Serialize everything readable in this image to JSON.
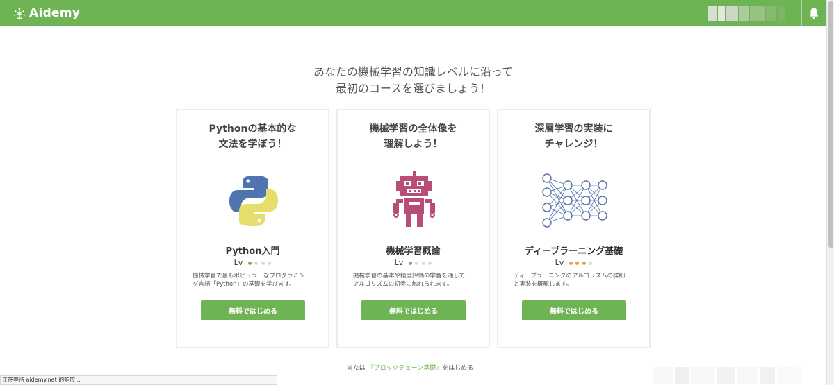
{
  "header": {
    "brand": "Aidemy",
    "logo_icon": "sparkle-logo-icon",
    "bell_icon": "bell-icon",
    "bg_color": "#6fb454"
  },
  "hero": {
    "line1": "あなたの機械学習の知識レベルに沿って",
    "line2": "最初のコースを選びましょう！"
  },
  "cards": [
    {
      "title1": "Pythonの基本的な",
      "title2": "文法を学ぼう！",
      "icon": "python-logo-icon",
      "course": "Python入門",
      "lv_label": "Lv",
      "level": 1,
      "level_max": 4,
      "level_color": "#6fb454",
      "desc1": "機械学習で最もポピュラーなプログラミン",
      "desc2": "グ言語「Python」の基礎を学びます。",
      "button": "無料ではじめる"
    },
    {
      "title1": "機械学習の全体像を",
      "title2": "理解しよう！",
      "icon": "robot-icon",
      "course": "機械学習概論",
      "lv_label": "Lv",
      "level": 1,
      "level_max": 4,
      "level_color": "#6fb454",
      "desc1": "機械学習の基本や精度評価の学習を通して",
      "desc2": "アルゴリズムの初歩に触れられます。",
      "button": "無料ではじめる"
    },
    {
      "title1": "深層学習の実装に",
      "title2": "チャレンジ！",
      "icon": "neural-network-icon",
      "course": "ディープラーニング基礎",
      "lv_label": "Lv",
      "level": 3,
      "level_max": 4,
      "level_color": "#f0a033",
      "desc1": "ディープラーニングのアルゴリズムの詳細",
      "desc2": "と実装を概観します。",
      "button": "無料ではじめる"
    }
  ],
  "footer": {
    "prefix": "または",
    "link": "『ブロックチェーン基礎』",
    "suffix": "をはじめる！"
  },
  "status_bar": {
    "text": "正在等待 aidemy.net 的响应..."
  }
}
